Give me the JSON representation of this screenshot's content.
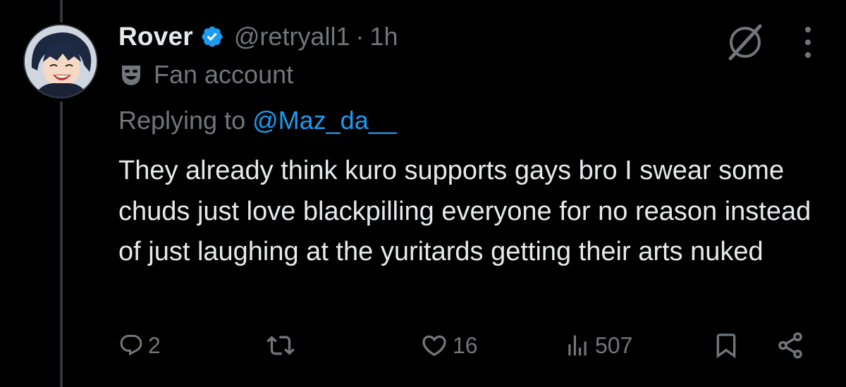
{
  "tweet": {
    "author": {
      "display_name": "Rover",
      "handle": "@retryall1",
      "verified": true,
      "verified_color": "#1d9bf0"
    },
    "separator": "·",
    "time": "1h",
    "label": {
      "icon": "theater-mask-icon",
      "text": "Fan account"
    },
    "reply": {
      "prefix": "Replying to ",
      "to_handle": "@Maz_da__"
    },
    "text": "They already think kuro supports gays bro I swear some chuds just love blackpilling everyone for no reason instead of just laughing at the yuritards getting their arts nuked",
    "metrics": {
      "replies": "2",
      "likes": "16",
      "views": "507"
    }
  },
  "icons": {
    "grok": "grok-icon",
    "more": "more-vertical-icon",
    "reply": "reply-icon",
    "retweet": "retweet-icon",
    "like": "heart-icon",
    "views": "analytics-icon",
    "bookmark": "bookmark-icon",
    "share": "share-icon"
  },
  "colors": {
    "background": "#000000",
    "text": "#e7e9ea",
    "secondary": "#71767b",
    "link": "#1d9bf0"
  }
}
